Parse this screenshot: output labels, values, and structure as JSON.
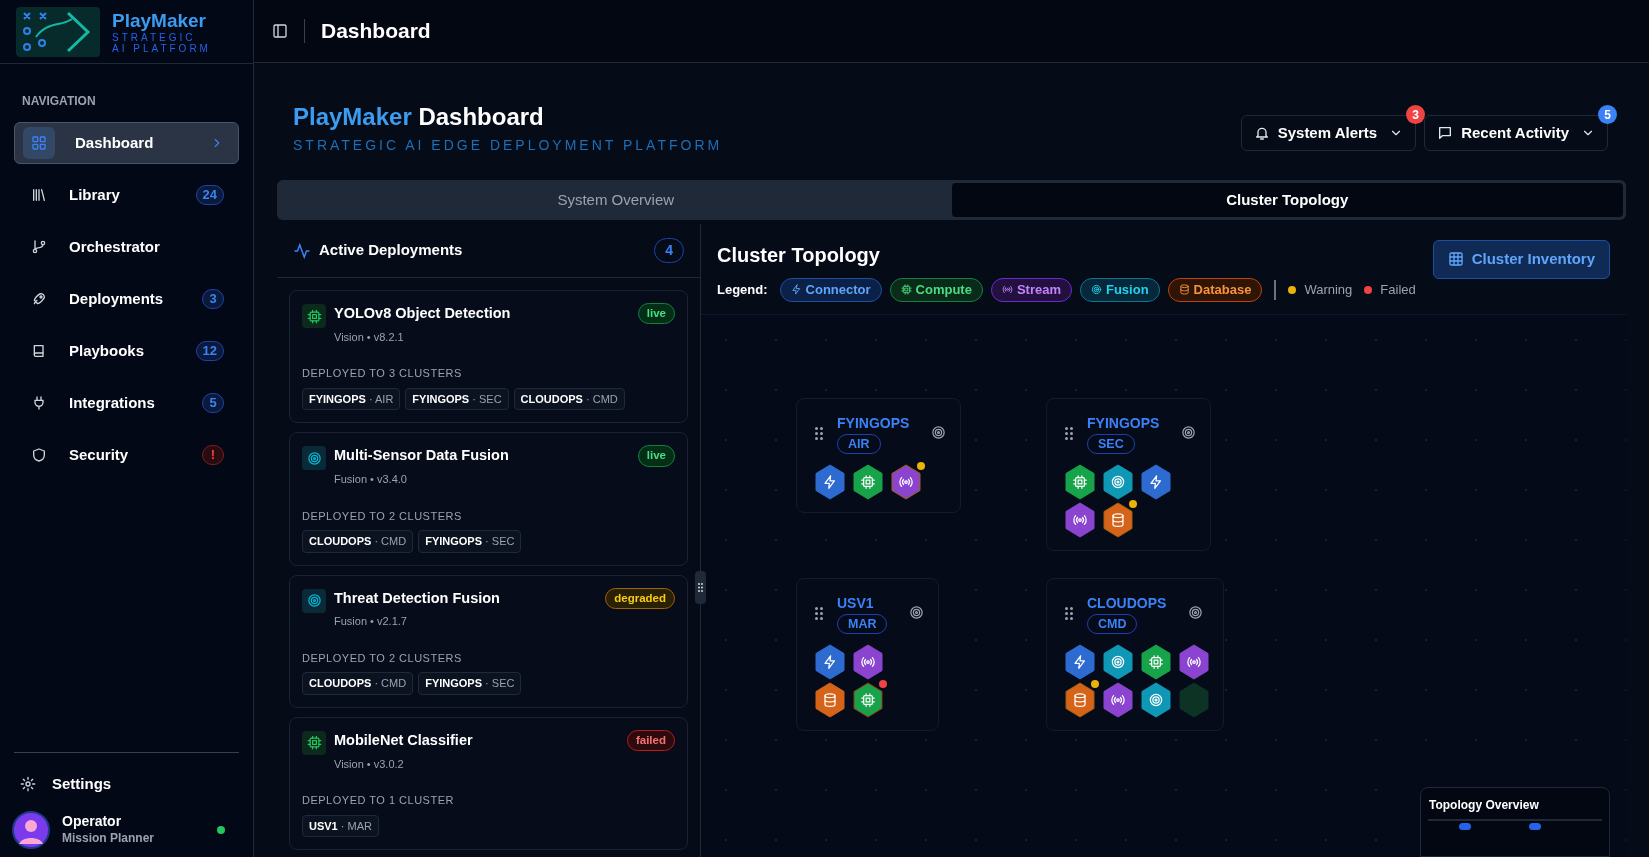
{
  "sidebar": {
    "brand": {
      "name": "PlayMaker",
      "tagline": "STRATEGIC AI PLATFORM"
    },
    "section_label": "NAVIGATION",
    "items": [
      {
        "label": "Dashboard",
        "selected": true
      },
      {
        "label": "Library",
        "selected": false,
        "badge": "24",
        "badge_alert": false
      },
      {
        "label": "Orchestrator",
        "selected": false
      },
      {
        "label": "Deployments",
        "selected": false,
        "badge": "3",
        "badge_alert": false
      },
      {
        "label": "Playbooks",
        "selected": false,
        "badge": "12",
        "badge_alert": false
      },
      {
        "label": "Integrations",
        "selected": false,
        "badge": "5",
        "badge_alert": false
      },
      {
        "label": "Security",
        "selected": false,
        "badge": "!",
        "badge_alert": true
      }
    ],
    "settings": "Settings",
    "user": {
      "name": "Operator",
      "role": "Mission Planner",
      "online": true
    }
  },
  "header": {
    "title": "Dashboard"
  },
  "page": {
    "title_brand": "PlayMaker",
    "title_rest": "Dashboard",
    "subtitle": "STRATEGIC AI EDGE DEPLOYMENT PLATFORM",
    "buttons": [
      {
        "label": "System Alerts",
        "count": "3",
        "color": "#ef4444"
      },
      {
        "label": "Recent Activity",
        "count": "5",
        "color": "#3b82f6"
      }
    ]
  },
  "tabs": [
    {
      "label": "System Overview",
      "selected": false
    },
    {
      "label": "Cluster Topology",
      "selected": true
    }
  ],
  "deployments": {
    "title": "Active Deployments",
    "count": "4",
    "items": [
      {
        "name": "YOLOv8 Object Detection",
        "kind": "compute",
        "meta": "Vision • v8.2.1",
        "status": "live",
        "clusters_label": "DEPLOYED TO 3 CLUSTERS",
        "clusters": [
          "**FYINGOPS** · AIR",
          "**FYINGOPS** · SEC",
          "**CLOUDOPS** · CMD"
        ]
      },
      {
        "name": "Multi-Sensor Data Fusion",
        "kind": "fusion",
        "meta": "Fusion • v3.4.0",
        "status": "live",
        "clusters_label": "DEPLOYED TO 2 CLUSTERS",
        "clusters": [
          "**CLOUDOPS** · CMD",
          "**FYINGOPS** · SEC"
        ]
      },
      {
        "name": "Threat Detection Fusion",
        "kind": "fusion",
        "meta": "Fusion • v2.1.7",
        "status": "degraded",
        "clusters_label": "DEPLOYED TO 2 CLUSTERS",
        "clusters": [
          "**CLOUDOPS** · CMD",
          "**FYINGOPS** · SEC"
        ]
      },
      {
        "name": "MobileNet Classifier",
        "kind": "compute",
        "meta": "Vision • v3.0.2",
        "status": "failed",
        "clusters_label": "DEPLOYED TO 1 CLUSTER",
        "clusters": [
          "**USV1** · MAR"
        ]
      }
    ]
  },
  "topology": {
    "title": "Cluster Topology",
    "inventory_button": "Cluster Inventory",
    "legend_label": "Legend:",
    "legend": [
      {
        "label": "Connector",
        "kind": "connector"
      },
      {
        "label": "Compute",
        "kind": "compute"
      },
      {
        "label": "Stream",
        "kind": "stream"
      },
      {
        "label": "Fusion",
        "kind": "fusion"
      },
      {
        "label": "Database",
        "kind": "database"
      }
    ],
    "status_legend": [
      {
        "label": "Warning",
        "kind": "warning"
      },
      {
        "label": "Failed",
        "kind": "failed"
      }
    ],
    "clusters": [
      {
        "name": "FYINGOPS",
        "zone": "AIR",
        "nodes": [
          {
            "kind": "connector",
            "warning": false,
            "failed": false
          },
          {
            "kind": "compute",
            "warning": false,
            "failed": false
          },
          {
            "kind": "stream",
            "warning": true,
            "failed": false
          }
        ]
      },
      {
        "name": "FYINGOPS",
        "zone": "SEC",
        "nodes": [
          {
            "kind": "compute",
            "warning": false,
            "failed": false
          },
          {
            "kind": "fusion",
            "warning": false,
            "failed": false
          },
          {
            "kind": "connector",
            "warning": false,
            "failed": false
          },
          {
            "kind": "stream",
            "warning": false,
            "failed": false
          },
          {
            "kind": "database",
            "warning": true,
            "failed": false
          }
        ]
      },
      {
        "name": "USV1",
        "zone": "MAR",
        "nodes": [
          {
            "kind": "connector",
            "warning": false,
            "failed": false
          },
          {
            "kind": "stream",
            "warning": false,
            "failed": false
          },
          {
            "kind": "database",
            "warning": false,
            "failed": false
          },
          {
            "kind": "compute",
            "warning": false,
            "failed": true
          }
        ]
      },
      {
        "name": "CLOUDOPS",
        "zone": "CMD",
        "nodes": [
          {
            "kind": "connector",
            "warning": false,
            "failed": false
          },
          {
            "kind": "fusion",
            "warning": false,
            "failed": false
          },
          {
            "kind": "compute",
            "warning": false,
            "failed": false
          },
          {
            "kind": "stream",
            "warning": false,
            "failed": false
          },
          {
            "kind": "database",
            "warning": true,
            "failed": false
          },
          {
            "kind": "stream",
            "warning": false,
            "failed": false
          },
          {
            "kind": "fusion",
            "warning": false,
            "failed": false
          },
          {
            "kind": "empty",
            "warning": false,
            "failed": false
          }
        ]
      }
    ],
    "overview_title": "Topology Overview"
  }
}
